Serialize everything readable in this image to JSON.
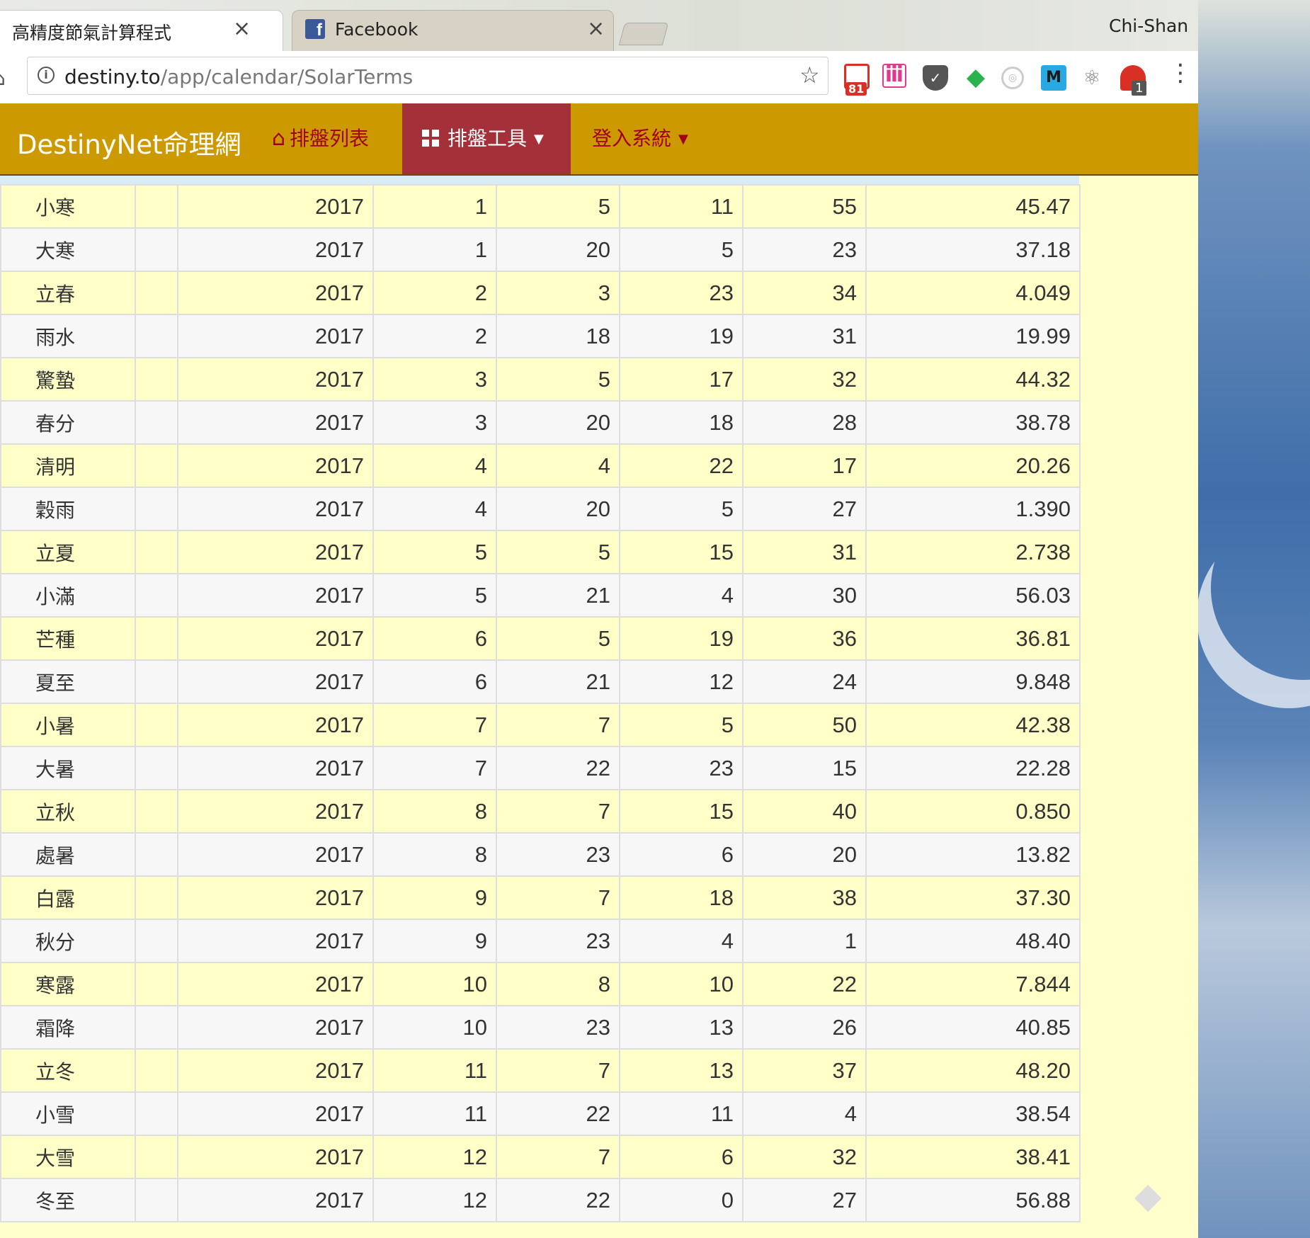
{
  "browser": {
    "tabs": [
      {
        "title": "高精度節氣計算程式",
        "active": true
      },
      {
        "title": "Facebook",
        "active": false
      }
    ],
    "profile_name": "Chi-Shan",
    "url_host": "destiny.to",
    "url_path": "/app/calendar/SolarTerms",
    "extensions": {
      "gmail_badge": "81",
      "red_badge": "1",
      "m_label": "M"
    }
  },
  "navbar": {
    "brand": "DestinyNet命理網",
    "items": [
      {
        "label": "排盤列表",
        "icon": "home-icon"
      },
      {
        "label": "排盤工具",
        "icon": "grid-icon",
        "dropdown": true,
        "active": true
      },
      {
        "label": "登入系統",
        "dropdown": true
      }
    ]
  },
  "table": {
    "rows": [
      {
        "name": "小寒",
        "extra": "",
        "year": "2017",
        "month": "1",
        "day": "5",
        "hour": "11",
        "minute": "55",
        "second": "45.47"
      },
      {
        "name": "大寒",
        "extra": "",
        "year": "2017",
        "month": "1",
        "day": "20",
        "hour": "5",
        "minute": "23",
        "second": "37.18"
      },
      {
        "name": "立春",
        "extra": "",
        "year": "2017",
        "month": "2",
        "day": "3",
        "hour": "23",
        "minute": "34",
        "second": "4.049"
      },
      {
        "name": "雨水",
        "extra": "",
        "year": "2017",
        "month": "2",
        "day": "18",
        "hour": "19",
        "minute": "31",
        "second": "19.99"
      },
      {
        "name": "驚蟄",
        "extra": "",
        "year": "2017",
        "month": "3",
        "day": "5",
        "hour": "17",
        "minute": "32",
        "second": "44.32"
      },
      {
        "name": "春分",
        "extra": "",
        "year": "2017",
        "month": "3",
        "day": "20",
        "hour": "18",
        "minute": "28",
        "second": "38.78"
      },
      {
        "name": "清明",
        "extra": "",
        "year": "2017",
        "month": "4",
        "day": "4",
        "hour": "22",
        "minute": "17",
        "second": "20.26"
      },
      {
        "name": "穀雨",
        "extra": "",
        "year": "2017",
        "month": "4",
        "day": "20",
        "hour": "5",
        "minute": "27",
        "second": "1.390"
      },
      {
        "name": "立夏",
        "extra": "",
        "year": "2017",
        "month": "5",
        "day": "5",
        "hour": "15",
        "minute": "31",
        "second": "2.738"
      },
      {
        "name": "小滿",
        "extra": "",
        "year": "2017",
        "month": "5",
        "day": "21",
        "hour": "4",
        "minute": "30",
        "second": "56.03"
      },
      {
        "name": "芒種",
        "extra": "",
        "year": "2017",
        "month": "6",
        "day": "5",
        "hour": "19",
        "minute": "36",
        "second": "36.81"
      },
      {
        "name": "夏至",
        "extra": "",
        "year": "2017",
        "month": "6",
        "day": "21",
        "hour": "12",
        "minute": "24",
        "second": "9.848"
      },
      {
        "name": "小暑",
        "extra": "",
        "year": "2017",
        "month": "7",
        "day": "7",
        "hour": "5",
        "minute": "50",
        "second": "42.38"
      },
      {
        "name": "大暑",
        "extra": "",
        "year": "2017",
        "month": "7",
        "day": "22",
        "hour": "23",
        "minute": "15",
        "second": "22.28"
      },
      {
        "name": "立秋",
        "extra": "",
        "year": "2017",
        "month": "8",
        "day": "7",
        "hour": "15",
        "minute": "40",
        "second": "0.850"
      },
      {
        "name": "處暑",
        "extra": "",
        "year": "2017",
        "month": "8",
        "day": "23",
        "hour": "6",
        "minute": "20",
        "second": "13.82"
      },
      {
        "name": "白露",
        "extra": "",
        "year": "2017",
        "month": "9",
        "day": "7",
        "hour": "18",
        "minute": "38",
        "second": "37.30"
      },
      {
        "name": "秋分",
        "extra": "",
        "year": "2017",
        "month": "9",
        "day": "23",
        "hour": "4",
        "minute": "1",
        "second": "48.40"
      },
      {
        "name": "寒露",
        "extra": "",
        "year": "2017",
        "month": "10",
        "day": "8",
        "hour": "10",
        "minute": "22",
        "second": "7.844"
      },
      {
        "name": "霜降",
        "extra": "",
        "year": "2017",
        "month": "10",
        "day": "23",
        "hour": "13",
        "minute": "26",
        "second": "40.85"
      },
      {
        "name": "立冬",
        "extra": "",
        "year": "2017",
        "month": "11",
        "day": "7",
        "hour": "13",
        "minute": "37",
        "second": "48.20"
      },
      {
        "name": "小雪",
        "extra": "",
        "year": "2017",
        "month": "11",
        "day": "22",
        "hour": "11",
        "minute": "4",
        "second": "38.54"
      },
      {
        "name": "大雪",
        "extra": "",
        "year": "2017",
        "month": "12",
        "day": "7",
        "hour": "6",
        "minute": "32",
        "second": "38.41"
      },
      {
        "name": "冬至",
        "extra": "",
        "year": "2017",
        "month": "12",
        "day": "22",
        "hour": "0",
        "minute": "27",
        "second": "56.88"
      }
    ]
  },
  "colors": {
    "navbar": "#cc9900",
    "nav_active": "#a4303a",
    "row_odd": "#ffffc8",
    "row_even": "#f7f7f7"
  }
}
